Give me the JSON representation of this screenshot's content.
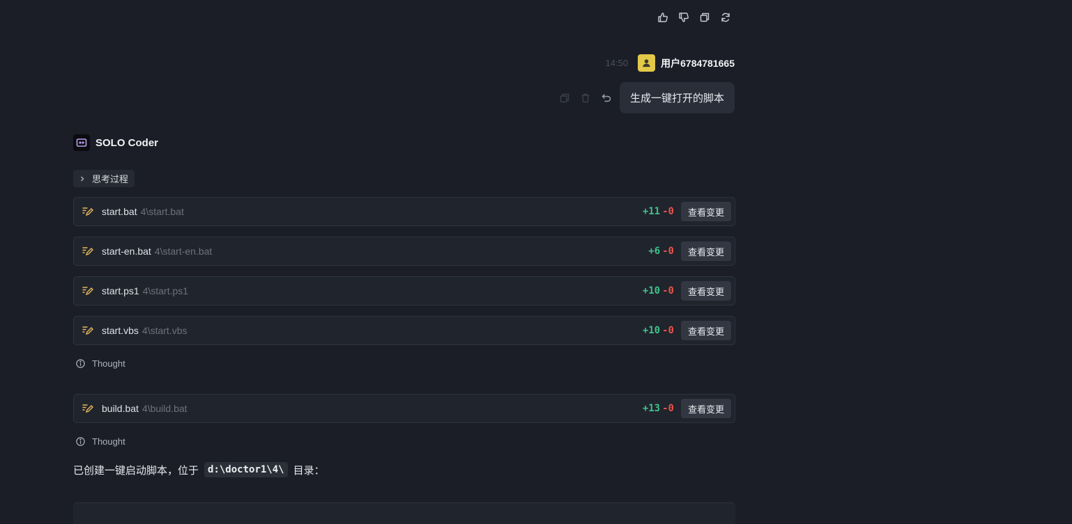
{
  "user": {
    "timestamp": "14:50",
    "name": "用户6784781665"
  },
  "message": {
    "text": "生成一键打开的脚本"
  },
  "agent": {
    "name": "SOLO Coder"
  },
  "thinking": {
    "label": "思考过程"
  },
  "files": [
    {
      "name": "start.bat",
      "path": "4\\start.bat",
      "added": "+11",
      "removed": "-0",
      "action": "查看变更"
    },
    {
      "name": "start-en.bat",
      "path": "4\\start-en.bat",
      "added": "+6",
      "removed": "-0",
      "action": "查看变更"
    },
    {
      "name": "start.ps1",
      "path": "4\\start.ps1",
      "added": "+10",
      "removed": "-0",
      "action": "查看变更"
    },
    {
      "name": "start.vbs",
      "path": "4\\start.vbs",
      "added": "+10",
      "removed": "-0",
      "action": "查看变更"
    },
    {
      "name": "build.bat",
      "path": "4\\build.bat",
      "added": "+13",
      "removed": "-0",
      "action": "查看变更"
    }
  ],
  "thought_labels": [
    "Thought",
    "Thought"
  ],
  "summary": {
    "before": "已创建一键启动脚本，位于",
    "code": "d:\\doctor1\\4\\",
    "after": "目录："
  },
  "icons": {
    "top": [
      "thumbs-up-icon",
      "thumbs-down-icon",
      "copy-icon",
      "refresh-icon"
    ],
    "message": [
      "copy-icon",
      "delete-icon",
      "undo-icon"
    ],
    "file": "file-edit-icon",
    "thought": "info-icon"
  },
  "colors": {
    "background": "#1b1e27",
    "card": "#20242d",
    "added": "#3fc28a",
    "removed": "#e5534b",
    "edit_icon": "#e6b85c",
    "avatar": "#e3c84a"
  }
}
